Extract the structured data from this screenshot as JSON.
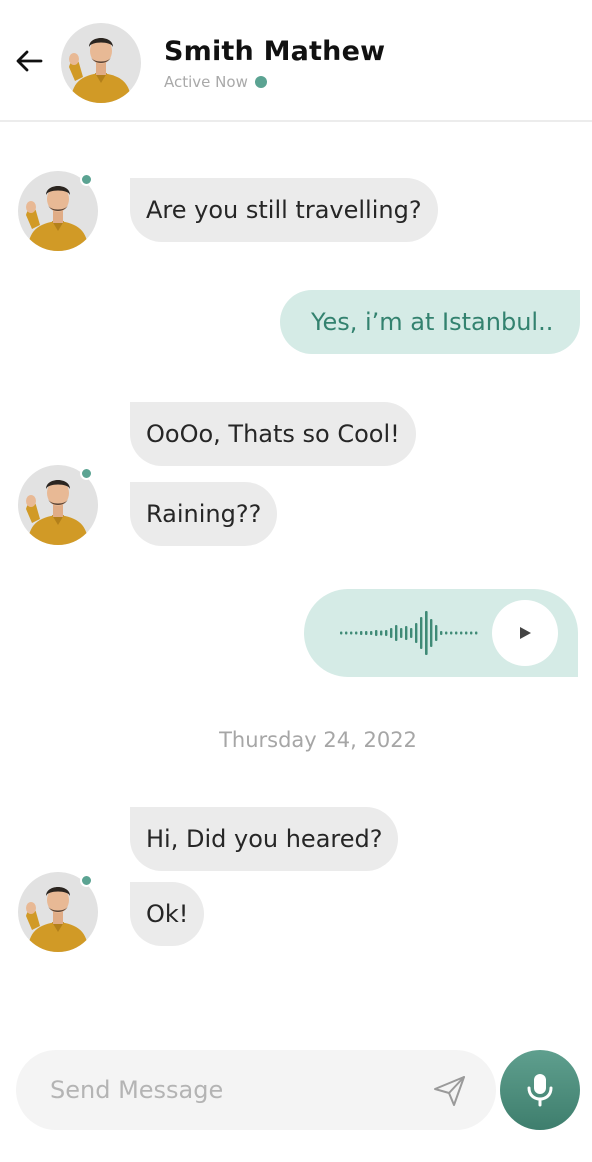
{
  "header": {
    "contact_name": "Smith Mathew",
    "status_text": "Active Now",
    "back_icon": "arrow-left-icon"
  },
  "colors": {
    "accent": "#5ba392",
    "incoming_bubble": "#ebebeb",
    "outgoing_bubble": "#d5ebe6",
    "outgoing_text": "#33826f",
    "mic_button": "#4a8a79"
  },
  "messages": [
    {
      "direction": "incoming",
      "text": "Are you still travelling?"
    },
    {
      "direction": "outgoing",
      "text": "Yes, i’m at Istanbul.."
    },
    {
      "direction": "incoming",
      "text": "OoOo, Thats so Cool!"
    },
    {
      "direction": "incoming",
      "text": "Raining??"
    },
    {
      "direction": "outgoing",
      "type": "voice",
      "icon": "play-icon"
    },
    {
      "direction": "incoming",
      "text": "Hi, Did you heared?"
    },
    {
      "direction": "incoming",
      "text": "Ok!"
    }
  ],
  "date_separator": "Thursday 24, 2022",
  "composer": {
    "placeholder": "Send Message",
    "value": "",
    "send_icon": "send-icon",
    "mic_icon": "microphone-icon"
  }
}
